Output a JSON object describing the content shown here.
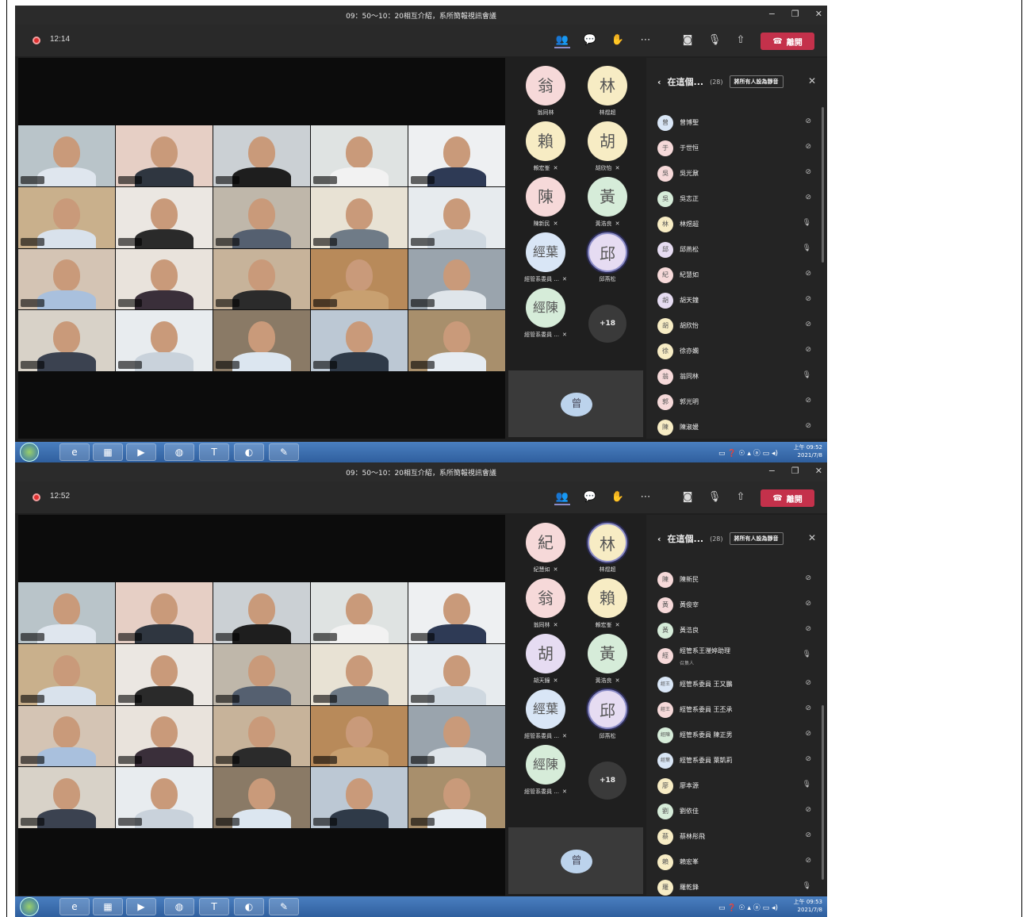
{
  "window": {
    "title": "09：50～10：20相互介紹，系所簡報視訊會議",
    "controls": [
      "−",
      "❐",
      "✕"
    ]
  },
  "toolbar": {
    "leave_label": "離開",
    "icons": [
      "people-icon",
      "chat-icon",
      "reactions-icon",
      "more-icon",
      "camera-off-icon",
      "mic-off-icon",
      "share-icon"
    ]
  },
  "screens": [
    {
      "timer": "12:14",
      "avatars": [
        {
          "char": "翁",
          "name": "翁同林",
          "color": "#f6d9d9",
          "mic": "",
          "ring": false
        },
        {
          "char": "林",
          "name": "林煜超",
          "color": "#f7ecc4",
          "mic": "",
          "ring": false
        },
        {
          "char": "賴",
          "name": "賴宏峯",
          "color": "#f7ecc4",
          "mic": "✕",
          "ring": false
        },
        {
          "char": "胡",
          "name": "胡欣怡",
          "color": "#f7ecc4",
          "mic": "✕",
          "ring": false
        },
        {
          "char": "陳",
          "name": "陳新民",
          "color": "#f6d9d9",
          "mic": "✕",
          "ring": false
        },
        {
          "char": "黃",
          "name": "黃浩良",
          "color": "#d6ecd9",
          "mic": "✕",
          "ring": false
        },
        {
          "char": "經葉",
          "name": "經管系委員 ...",
          "color": "#d9e6f6",
          "mic": "✕",
          "ring": false
        },
        {
          "char": "邱",
          "name": "邱燕松",
          "color": "#e6dcf2",
          "mic": "",
          "ring": true
        },
        {
          "char": "經陳",
          "name": "經管系委員 ...",
          "color": "#d6ecd9",
          "mic": "✕",
          "ring": false
        }
      ],
      "more": "+18",
      "self_char": "曾",
      "panel": {
        "title": "在這個...",
        "count": "(28)",
        "mute_all": "將所有人設為靜音",
        "participants": [
          {
            "char": "曾",
            "name": "曾博聖",
            "sub": "",
            "color": "#d9e6f6",
            "mic": "muted"
          },
          {
            "char": "于",
            "name": "于世恒",
            "sub": "",
            "color": "#f6d9d9",
            "mic": "muted"
          },
          {
            "char": "吳",
            "name": "吳光鼐",
            "sub": "",
            "color": "#f6d9d9",
            "mic": "muted"
          },
          {
            "char": "吳",
            "name": "吳志正",
            "sub": "",
            "color": "#d6ecd9",
            "mic": "muted"
          },
          {
            "char": "林",
            "name": "林煜超",
            "sub": "",
            "color": "#f7ecc4",
            "mic": "on"
          },
          {
            "char": "邱",
            "name": "邱燕松",
            "sub": "",
            "color": "#e6dcf2",
            "mic": "on"
          },
          {
            "char": "紀",
            "name": "紀慧如",
            "sub": "",
            "color": "#f6d9d9",
            "mic": "muted"
          },
          {
            "char": "胡",
            "name": "胡天鐘",
            "sub": "",
            "color": "#e6dcf2",
            "mic": "muted"
          },
          {
            "char": "胡",
            "name": "胡欣怡",
            "sub": "",
            "color": "#f7ecc4",
            "mic": "muted"
          },
          {
            "char": "徐",
            "name": "徐亦嫻",
            "sub": "",
            "color": "#f7ecc4",
            "mic": "muted"
          },
          {
            "char": "翁",
            "name": "翁同林",
            "sub": "",
            "color": "#f6d9d9",
            "mic": "on"
          },
          {
            "char": "郭",
            "name": "郭光明",
            "sub": "",
            "color": "#f6d9d9",
            "mic": "muted"
          },
          {
            "char": "陳",
            "name": "陳淑媛",
            "sub": "",
            "color": "#f7ecc4",
            "mic": "muted"
          }
        ]
      },
      "tray_time": "上午 09:52",
      "tray_date": "2021/7/8"
    },
    {
      "timer": "12:52",
      "avatars": [
        {
          "char": "紀",
          "name": "紀慧如",
          "color": "#f6d9d9",
          "mic": "✕",
          "ring": false
        },
        {
          "char": "林",
          "name": "林煜超",
          "color": "#f7ecc4",
          "mic": "",
          "ring": true
        },
        {
          "char": "翁",
          "name": "翁同林",
          "color": "#f6d9d9",
          "mic": "✕",
          "ring": false
        },
        {
          "char": "賴",
          "name": "賴宏峯",
          "color": "#f7ecc4",
          "mic": "✕",
          "ring": false
        },
        {
          "char": "胡",
          "name": "胡天鐘",
          "color": "#e6dcf2",
          "mic": "✕",
          "ring": false
        },
        {
          "char": "黃",
          "name": "黃浩良",
          "color": "#d6ecd9",
          "mic": "✕",
          "ring": false
        },
        {
          "char": "經葉",
          "name": "經管系委員 ...",
          "color": "#d9e6f6",
          "mic": "✕",
          "ring": false
        },
        {
          "char": "邱",
          "name": "邱燕松",
          "color": "#e6dcf2",
          "mic": "",
          "ring": true
        },
        {
          "char": "經陳",
          "name": "經管系委員 ...",
          "color": "#d6ecd9",
          "mic": "✕",
          "ring": false
        }
      ],
      "more": "+18",
      "self_char": "曾",
      "panel": {
        "title": "在這個...",
        "count": "(28)",
        "mute_all": "將所有人設為靜音",
        "participants": [
          {
            "char": "陳",
            "name": "陳新民",
            "sub": "",
            "color": "#f6d9d9",
            "mic": "muted"
          },
          {
            "char": "黃",
            "name": "黃俊宰",
            "sub": "",
            "color": "#f6d9d9",
            "mic": "muted"
          },
          {
            "char": "黃",
            "name": "黃浩良",
            "sub": "",
            "color": "#d6ecd9",
            "mic": "muted"
          },
          {
            "char": "經",
            "name": "經管系王瀅婷助理",
            "sub": "召集人",
            "color": "#f6d9d9",
            "mic": "on"
          },
          {
            "char": "經王",
            "name": "經管系委員 王又鵬",
            "sub": "",
            "color": "#d9e6f6",
            "mic": "muted"
          },
          {
            "char": "經王",
            "name": "經管系委員 王丕承",
            "sub": "",
            "color": "#f6d9d9",
            "mic": "muted"
          },
          {
            "char": "經陳",
            "name": "經管系委員 陳正男",
            "sub": "",
            "color": "#d6ecd9",
            "mic": "muted"
          },
          {
            "char": "經葉",
            "name": "經管系委員 葉凱莉",
            "sub": "",
            "color": "#d9e6f6",
            "mic": "muted"
          },
          {
            "char": "廖",
            "name": "廖本源",
            "sub": "",
            "color": "#f7ecc4",
            "mic": "on"
          },
          {
            "char": "劉",
            "name": "劉依佳",
            "sub": "",
            "color": "#d6ecd9",
            "mic": "muted"
          },
          {
            "char": "蔡",
            "name": "蔡林彤飛",
            "sub": "",
            "color": "#f7ecc4",
            "mic": "muted"
          },
          {
            "char": "賴",
            "name": "賴宏峯",
            "sub": "",
            "color": "#f7ecc4",
            "mic": "muted"
          },
          {
            "char": "羅",
            "name": "羅乾鋒",
            "sub": "",
            "color": "#f7ecc4",
            "mic": "on"
          }
        ]
      },
      "tray_time": "上午 09:53",
      "tray_date": "2021/7/8"
    }
  ],
  "tiles": [
    {
      "bg": "#b9c4c9",
      "shirt": "#dfe6ee"
    },
    {
      "bg": "#e6cfc5",
      "shirt": "#2f3640"
    },
    {
      "bg": "#cbd0d4",
      "shirt": "#1e1e1e"
    },
    {
      "bg": "#dfe3e2",
      "shirt": "#f2f2f2"
    },
    {
      "bg": "#eef0f2",
      "shirt": "#2e3a55"
    },
    {
      "bg": "#c9b08c",
      "shirt": "#d9e2ec"
    },
    {
      "bg": "#ebe7e2",
      "shirt": "#2a2a2a"
    },
    {
      "bg": "#bfb7aa",
      "shirt": "#556070"
    },
    {
      "bg": "#e8e2d4",
      "shirt": "#6f7b87"
    },
    {
      "bg": "#e7ebee",
      "shirt": "#cfd8e0"
    },
    {
      "bg": "#d4c4b4",
      "shirt": "#a9c0dd"
    },
    {
      "bg": "#e9e3dc",
      "shirt": "#3a2f3a"
    },
    {
      "bg": "#c7b39a",
      "shirt": "#2b2b2b"
    },
    {
      "bg": "#b88a5a",
      "shirt": "#c8a070"
    },
    {
      "bg": "#9aa4ad",
      "shirt": "#dfe5ea"
    },
    {
      "bg": "#d8d2c8",
      "shirt": "#3b4250"
    },
    {
      "bg": "#e8ecef",
      "shirt": "#c9d2db"
    },
    {
      "bg": "#8a7a66",
      "shirt": "#dce6f0"
    },
    {
      "bg": "#bcc8d4",
      "shirt": "#2f3a48"
    },
    {
      "bg": "#a88f6c",
      "shirt": "#e6ecf2"
    }
  ],
  "taskbar": {
    "apps": [
      "◉",
      "e",
      "▦",
      "▶",
      "◍",
      "T",
      "◐",
      "✎"
    ],
    "tray": "▭ ❓ ☉ ▴ ⓐ ▭ ◂)"
  }
}
